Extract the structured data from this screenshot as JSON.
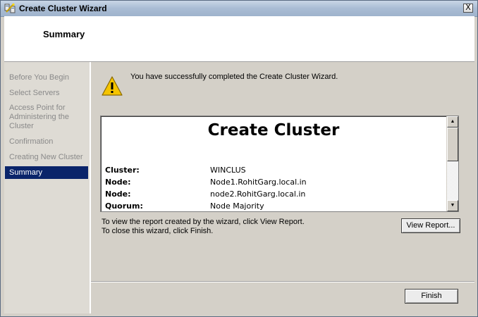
{
  "window": {
    "title": "Create Cluster Wizard",
    "close_glyph": "X"
  },
  "header": {
    "title": "Summary"
  },
  "steps": [
    {
      "label": "Before You Begin"
    },
    {
      "label": "Select Servers"
    },
    {
      "label": "Access Point for Administering the Cluster"
    },
    {
      "label": "Confirmation"
    },
    {
      "label": "Creating New Cluster"
    },
    {
      "label": "Summary"
    }
  ],
  "content": {
    "success_message": "You  have successfully completed the Create Cluster Wizard.",
    "report": {
      "title": "Create Cluster",
      "rows": [
        {
          "label": "Cluster:",
          "value": "WINCLUS"
        },
        {
          "label": "Node:",
          "value": "Node1.RohitGarg.local.in"
        },
        {
          "label": "Node:",
          "value": "node2.RohitGarg.local.in"
        },
        {
          "label": "Quorum:",
          "value": "Node Majority"
        }
      ]
    },
    "hint_report": "To view the report created by the wizard, click View Report.",
    "hint_close": "To close this wizard, click Finish.",
    "view_report_label": "View Report...",
    "finish_label": "Finish"
  },
  "icons": {
    "title": "cluster-wizard-icon",
    "status": "warning-icon"
  },
  "colors": {
    "active_step_bg": "#0a246a",
    "inactive_step_text": "#8a8a8a",
    "warning_yellow": "#f5c400"
  }
}
